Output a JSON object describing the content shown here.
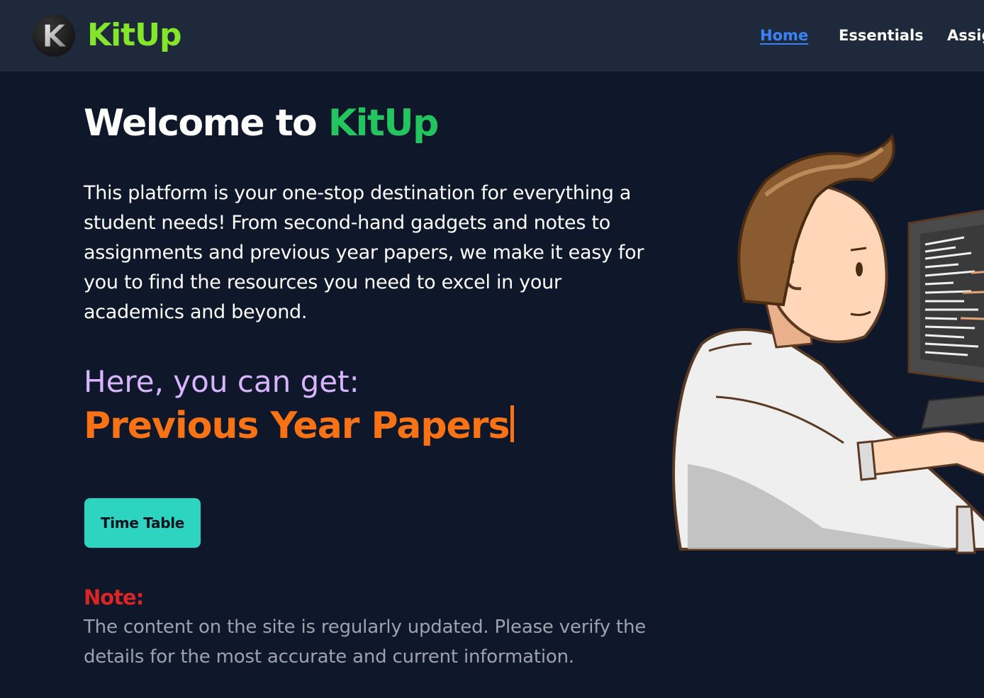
{
  "header": {
    "brand": "KitUp",
    "logo_letter": "K",
    "nav": [
      {
        "label": "Home",
        "active": true
      },
      {
        "label": "Essentials",
        "active": false
      },
      {
        "label": "Assig",
        "active": false
      }
    ]
  },
  "hero": {
    "title_prefix": "Welcome to",
    "title_accent": "KitUp",
    "intro": "This platform is your one-stop destination for everything a student needs! From second-hand gadgets and notes to assignments and previous year papers, we make it easy for you to find the resources you need to excel in your academics and beyond.",
    "subhead": "Here, you can get:",
    "typed_text": "Previous Year Papers",
    "button_label": "Time Table",
    "note_label": "Note:",
    "note_text": "The content on the site is regularly updated. Please verify the details for the most accurate and current information.",
    "illustration": "student-at-computer-illustration"
  },
  "colors": {
    "background": "#0f172a",
    "navbar": "#1e293b",
    "brand": "#84e62b",
    "title_accent": "#22c55e",
    "nav_active": "#3b82f6",
    "subhead": "#d8b4fe",
    "typed": "#f97316",
    "button": "#2dd4bf",
    "note_label": "#dc2626",
    "note_text": "#9ca3af"
  }
}
